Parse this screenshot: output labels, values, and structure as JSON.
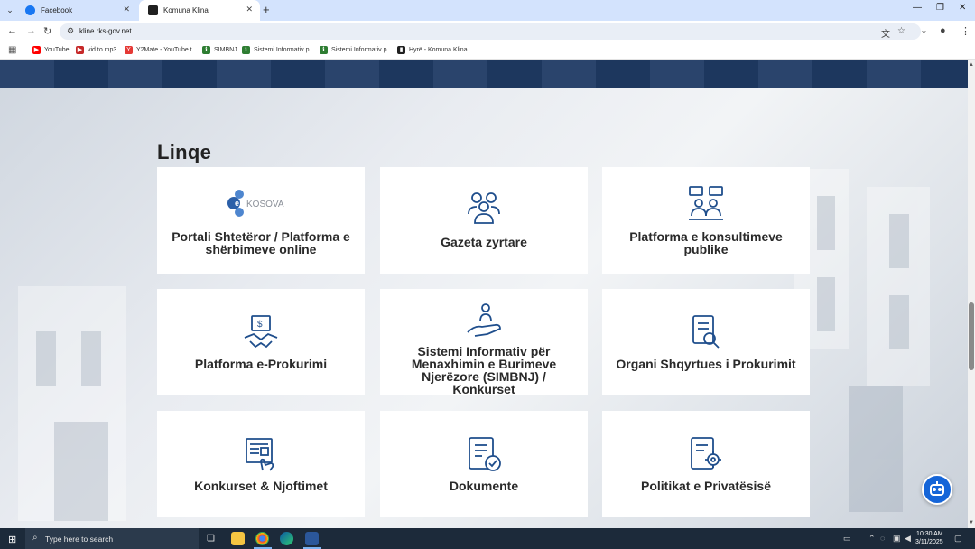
{
  "browser": {
    "tabs": [
      {
        "title": "Facebook",
        "favicon_color": "#1877f2",
        "active": false
      },
      {
        "title": "Komuna Klina",
        "favicon_color": "#202020",
        "active": true
      }
    ],
    "url": "klinе.rks-gov.net",
    "bookmarks": [
      {
        "label": "YouTube",
        "icon": "youtube-icon",
        "color": "#ff0000"
      },
      {
        "label": "vid to mp3",
        "icon": "vidtomp3-icon",
        "color": "#c62828"
      },
      {
        "label": "Y2Mate - YouTube t...",
        "icon": "y2mate-icon",
        "color": "#e53935"
      },
      {
        "label": "SIMBNJ",
        "icon": "simbnj-icon",
        "color": "#2e7d32"
      },
      {
        "label": "Sistemi Informativ p...",
        "icon": "simbnj-icon",
        "color": "#2e7d32"
      },
      {
        "label": "Sistemi Informativ p...",
        "icon": "simbnj-icon",
        "color": "#2e7d32"
      },
      {
        "label": "Hyrë - Komuna Klina...",
        "icon": "komuna-icon",
        "color": "#202020"
      }
    ]
  },
  "page": {
    "section_title": "Linqe",
    "cards": [
      {
        "label": "Portali Shtetëror / Platforma e shërbimeve online",
        "icon": "ekosova-logo",
        "logo_text": "KOSOVA"
      },
      {
        "label": "Gazeta zyrtare",
        "icon": "people-group-icon"
      },
      {
        "label": "Platforma e konsultimeve publike",
        "icon": "consultation-icon"
      },
      {
        "label": "Platforma e-Prokurimi",
        "icon": "handshake-money-icon"
      },
      {
        "label": "Sistemi Informativ për Menaxhimin e Burimeve Njerëzore (SIMBNJ) / Konkurset",
        "icon": "hand-person-icon"
      },
      {
        "label": "Organi Shqyrtues i Prokurimit",
        "icon": "document-search-icon"
      },
      {
        "label": "Konkurset & Njoftimet",
        "icon": "news-hand-icon"
      },
      {
        "label": "Dokumente",
        "icon": "document-check-icon"
      },
      {
        "label": "Politikat e Privatësisë",
        "icon": "document-gear-icon"
      }
    ],
    "accent_color": "#1f4e8c"
  },
  "taskbar": {
    "search_placeholder": "Type here to search",
    "time": "10:30 AM",
    "date": "3/11/2025"
  }
}
